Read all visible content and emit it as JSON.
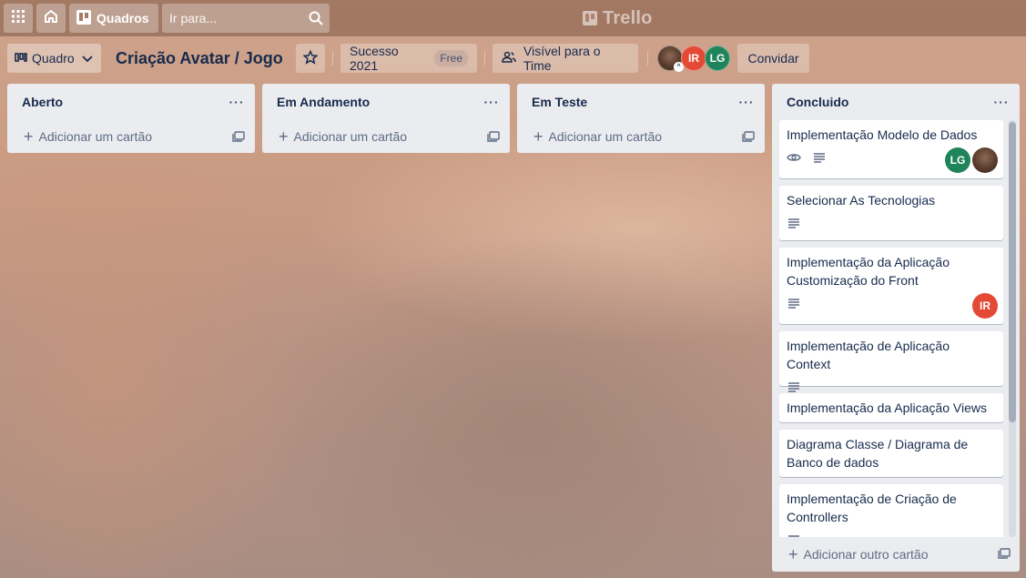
{
  "header": {
    "boards_label": "Quadros",
    "search_placeholder": "Ir para...",
    "logo_text": "Trello"
  },
  "board": {
    "view_label": "Quadro",
    "title": "Criação Avatar / Jogo",
    "team_name": "Sucesso 2021",
    "team_badge": "Free",
    "visibility": "Visível para o Time",
    "members": [
      "IR",
      "LG"
    ],
    "invite_label": "Convidar"
  },
  "lists": [
    {
      "name": "Aberto",
      "add_label": "Adicionar um cartão"
    },
    {
      "name": "Em Andamento",
      "add_label": "Adicionar um cartão"
    },
    {
      "name": "Em Teste",
      "add_label": "Adicionar um cartão"
    },
    {
      "name": "Concluido",
      "add_label": "Adicionar outro cartão",
      "cards": [
        {
          "title": "Implementação Modelo de Dados",
          "members": [
            "LG"
          ]
        },
        {
          "title": "Selecionar As Tecnologias"
        },
        {
          "title": "Implementação da Aplicação Customização do Front",
          "members": [
            "IR"
          ]
        },
        {
          "title": "Implementação de Aplicação Context"
        },
        {
          "title": "Implementação da Aplicação Views"
        },
        {
          "title": "Diagrama Classe / Diagrama de Banco de dados"
        },
        {
          "title": "Implementação de Criação de Controllers"
        }
      ]
    }
  ],
  "icons": {
    "apps": "apps-grid-icon",
    "home": "home-icon",
    "boards": "boards-icon",
    "search": "search-icon",
    "star": "star-icon",
    "visibility": "team-visibility-icon",
    "more": "more-dots-icon",
    "plus": "plus-icon",
    "template": "card-template-icon",
    "watch": "eye-icon",
    "description": "description-icon"
  },
  "colors": {
    "ir_avatar": "#e34935",
    "lg_avatar": "#1f845a",
    "list_bg": "#ebecf0"
  }
}
